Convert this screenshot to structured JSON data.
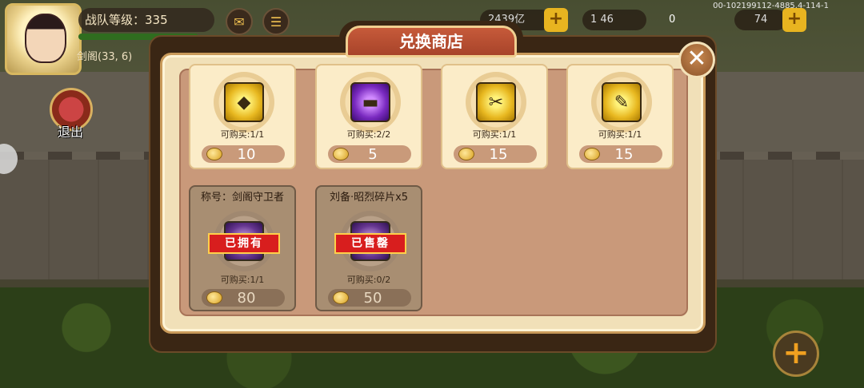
{
  "hud": {
    "team_level_label": "战队等级：335",
    "location": "剑阁(33, 6)",
    "exit_label": "退出",
    "currency_1": "2439亿",
    "currency_2": "1 46",
    "currency_3": "0",
    "currency_4": "74",
    "version": "00-102199112-4885.4-114-1",
    "icons": {
      "mail": "mail-icon",
      "menu": "list-icon",
      "plus": "plus-icon"
    }
  },
  "shop": {
    "title": "兑换商店",
    "close": "✕",
    "items": [
      {
        "name": "",
        "icon": "gold-token-icon",
        "limit": "可购买:1/1",
        "price": "10"
      },
      {
        "name": "",
        "icon": "purple-scroll-icon",
        "limit": "可购买:2/2",
        "price": "5"
      },
      {
        "name": "",
        "icon": "pliers-icon",
        "limit": "可购买:1/1",
        "price": "15"
      },
      {
        "name": "",
        "icon": "screwdriver-icon",
        "limit": "可购买:1/1",
        "price": "15"
      },
      {
        "name": "称号：剑阁守卫者",
        "icon": "title-badge-icon",
        "limit": "可购买:1/1",
        "price": "80",
        "stamp": "已拥有"
      },
      {
        "name": "刘备·昭烈碎片x5",
        "icon": "hero-shard-icon",
        "limit": "可购买:0/2",
        "price": "50",
        "stamp": "已售罄"
      }
    ]
  },
  "colors": {
    "title_plate": "#c65a3a",
    "stamp": "#d81e1e",
    "card_available": "#fbecc8",
    "card_unavailable": "#a88e72"
  }
}
